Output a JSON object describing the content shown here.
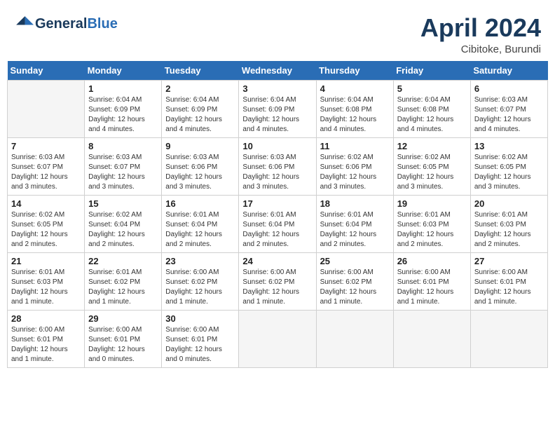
{
  "header": {
    "logo_general": "General",
    "logo_blue": "Blue",
    "month": "April 2024",
    "location": "Cibitoke, Burundi"
  },
  "days_of_week": [
    "Sunday",
    "Monday",
    "Tuesday",
    "Wednesday",
    "Thursday",
    "Friday",
    "Saturday"
  ],
  "weeks": [
    [
      {
        "day": "",
        "info": ""
      },
      {
        "day": "1",
        "info": "Sunrise: 6:04 AM\nSunset: 6:09 PM\nDaylight: 12 hours\nand 4 minutes."
      },
      {
        "day": "2",
        "info": "Sunrise: 6:04 AM\nSunset: 6:09 PM\nDaylight: 12 hours\nand 4 minutes."
      },
      {
        "day": "3",
        "info": "Sunrise: 6:04 AM\nSunset: 6:09 PM\nDaylight: 12 hours\nand 4 minutes."
      },
      {
        "day": "4",
        "info": "Sunrise: 6:04 AM\nSunset: 6:08 PM\nDaylight: 12 hours\nand 4 minutes."
      },
      {
        "day": "5",
        "info": "Sunrise: 6:04 AM\nSunset: 6:08 PM\nDaylight: 12 hours\nand 4 minutes."
      },
      {
        "day": "6",
        "info": "Sunrise: 6:03 AM\nSunset: 6:07 PM\nDaylight: 12 hours\nand 4 minutes."
      }
    ],
    [
      {
        "day": "7",
        "info": "Sunrise: 6:03 AM\nSunset: 6:07 PM\nDaylight: 12 hours\nand 3 minutes."
      },
      {
        "day": "8",
        "info": "Sunrise: 6:03 AM\nSunset: 6:07 PM\nDaylight: 12 hours\nand 3 minutes."
      },
      {
        "day": "9",
        "info": "Sunrise: 6:03 AM\nSunset: 6:06 PM\nDaylight: 12 hours\nand 3 minutes."
      },
      {
        "day": "10",
        "info": "Sunrise: 6:03 AM\nSunset: 6:06 PM\nDaylight: 12 hours\nand 3 minutes."
      },
      {
        "day": "11",
        "info": "Sunrise: 6:02 AM\nSunset: 6:06 PM\nDaylight: 12 hours\nand 3 minutes."
      },
      {
        "day": "12",
        "info": "Sunrise: 6:02 AM\nSunset: 6:05 PM\nDaylight: 12 hours\nand 3 minutes."
      },
      {
        "day": "13",
        "info": "Sunrise: 6:02 AM\nSunset: 6:05 PM\nDaylight: 12 hours\nand 3 minutes."
      }
    ],
    [
      {
        "day": "14",
        "info": "Sunrise: 6:02 AM\nSunset: 6:05 PM\nDaylight: 12 hours\nand 2 minutes."
      },
      {
        "day": "15",
        "info": "Sunrise: 6:02 AM\nSunset: 6:04 PM\nDaylight: 12 hours\nand 2 minutes."
      },
      {
        "day": "16",
        "info": "Sunrise: 6:01 AM\nSunset: 6:04 PM\nDaylight: 12 hours\nand 2 minutes."
      },
      {
        "day": "17",
        "info": "Sunrise: 6:01 AM\nSunset: 6:04 PM\nDaylight: 12 hours\nand 2 minutes."
      },
      {
        "day": "18",
        "info": "Sunrise: 6:01 AM\nSunset: 6:04 PM\nDaylight: 12 hours\nand 2 minutes."
      },
      {
        "day": "19",
        "info": "Sunrise: 6:01 AM\nSunset: 6:03 PM\nDaylight: 12 hours\nand 2 minutes."
      },
      {
        "day": "20",
        "info": "Sunrise: 6:01 AM\nSunset: 6:03 PM\nDaylight: 12 hours\nand 2 minutes."
      }
    ],
    [
      {
        "day": "21",
        "info": "Sunrise: 6:01 AM\nSunset: 6:03 PM\nDaylight: 12 hours\nand 1 minute."
      },
      {
        "day": "22",
        "info": "Sunrise: 6:01 AM\nSunset: 6:02 PM\nDaylight: 12 hours\nand 1 minute."
      },
      {
        "day": "23",
        "info": "Sunrise: 6:00 AM\nSunset: 6:02 PM\nDaylight: 12 hours\nand 1 minute."
      },
      {
        "day": "24",
        "info": "Sunrise: 6:00 AM\nSunset: 6:02 PM\nDaylight: 12 hours\nand 1 minute."
      },
      {
        "day": "25",
        "info": "Sunrise: 6:00 AM\nSunset: 6:02 PM\nDaylight: 12 hours\nand 1 minute."
      },
      {
        "day": "26",
        "info": "Sunrise: 6:00 AM\nSunset: 6:01 PM\nDaylight: 12 hours\nand 1 minute."
      },
      {
        "day": "27",
        "info": "Sunrise: 6:00 AM\nSunset: 6:01 PM\nDaylight: 12 hours\nand 1 minute."
      }
    ],
    [
      {
        "day": "28",
        "info": "Sunrise: 6:00 AM\nSunset: 6:01 PM\nDaylight: 12 hours\nand 1 minute."
      },
      {
        "day": "29",
        "info": "Sunrise: 6:00 AM\nSunset: 6:01 PM\nDaylight: 12 hours\nand 0 minutes."
      },
      {
        "day": "30",
        "info": "Sunrise: 6:00 AM\nSunset: 6:01 PM\nDaylight: 12 hours\nand 0 minutes."
      },
      {
        "day": "",
        "info": ""
      },
      {
        "day": "",
        "info": ""
      },
      {
        "day": "",
        "info": ""
      },
      {
        "day": "",
        "info": ""
      }
    ]
  ]
}
